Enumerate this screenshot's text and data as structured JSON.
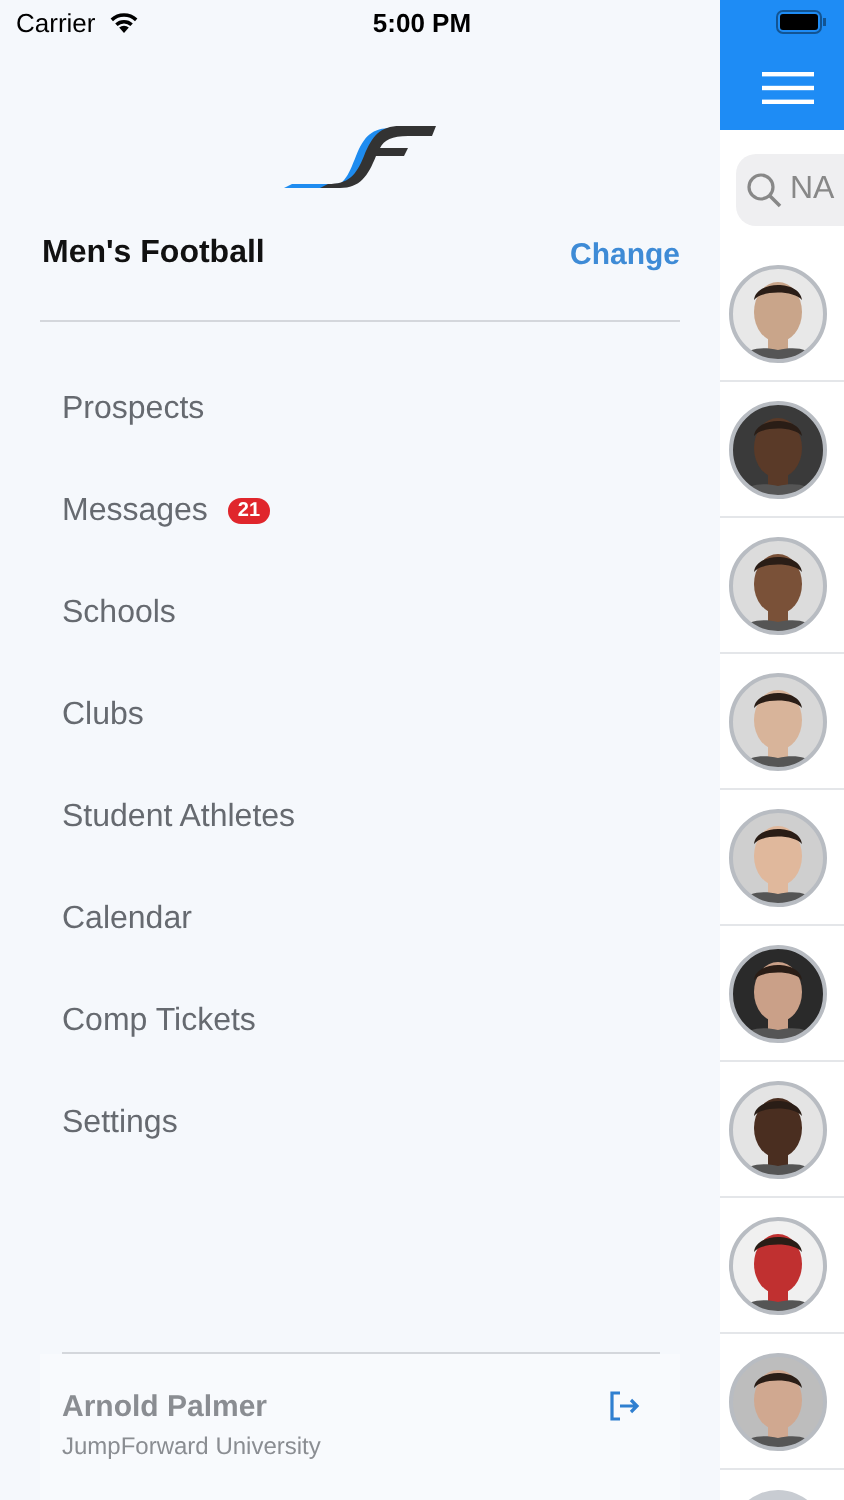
{
  "status_bar": {
    "carrier": "Carrier",
    "time": "5:00 PM"
  },
  "drawer": {
    "team": "Men's Football",
    "change_label": "Change",
    "menu": [
      {
        "label": "Prospects"
      },
      {
        "label": "Messages",
        "badge": "21"
      },
      {
        "label": "Schools"
      },
      {
        "label": "Clubs"
      },
      {
        "label": "Student Athletes"
      },
      {
        "label": "Calendar"
      },
      {
        "label": "Comp Tickets"
      },
      {
        "label": "Settings"
      }
    ],
    "user": {
      "name": "Arnold Palmer",
      "org": "JumpForward University"
    }
  },
  "list": {
    "search_placeholder": "NA",
    "rows": [
      {
        "kind": "picture"
      },
      {
        "kind": "picture"
      },
      {
        "kind": "picture"
      },
      {
        "kind": "picture"
      },
      {
        "kind": "picture"
      },
      {
        "kind": "picture"
      },
      {
        "kind": "picture"
      },
      {
        "kind": "picture"
      },
      {
        "kind": "picture"
      },
      {
        "kind": "placeholder"
      }
    ]
  }
}
